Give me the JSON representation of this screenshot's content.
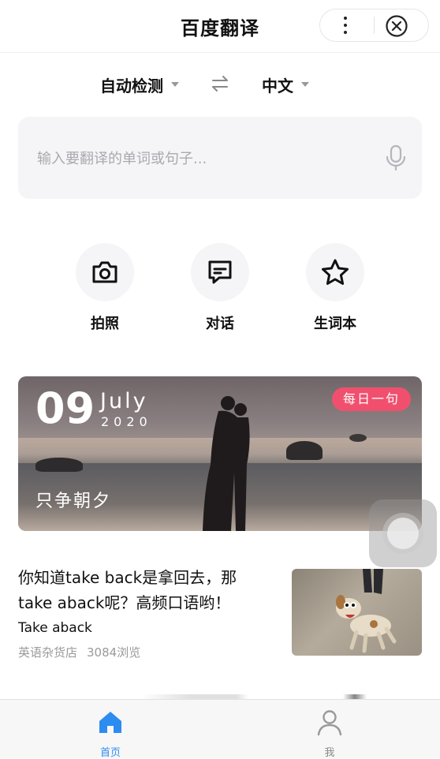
{
  "header": {
    "title": "百度翻译"
  },
  "languages": {
    "source": "自动检测",
    "target": "中文"
  },
  "input": {
    "placeholder": "输入要翻译的单词或句子..."
  },
  "features": [
    {
      "label": "拍照",
      "icon": "camera-icon"
    },
    {
      "label": "对话",
      "icon": "chat-icon"
    },
    {
      "label": "生词本",
      "icon": "star-icon"
    }
  ],
  "daily": {
    "day": "09",
    "month": "July",
    "year": "2020",
    "badge": "每日一句",
    "quote": "只争朝夕"
  },
  "article": {
    "title": "你知道take back是拿回去，那take aback呢？高频口语哟！",
    "subtitle": "Take aback",
    "source": "英语杂货店",
    "views": "3084浏览"
  },
  "tabs": [
    {
      "label": "首页",
      "icon": "home-icon",
      "active": true,
      "color": "#2d8cf0"
    },
    {
      "label": "我",
      "icon": "user-icon",
      "active": false,
      "color": "#888888"
    }
  ]
}
